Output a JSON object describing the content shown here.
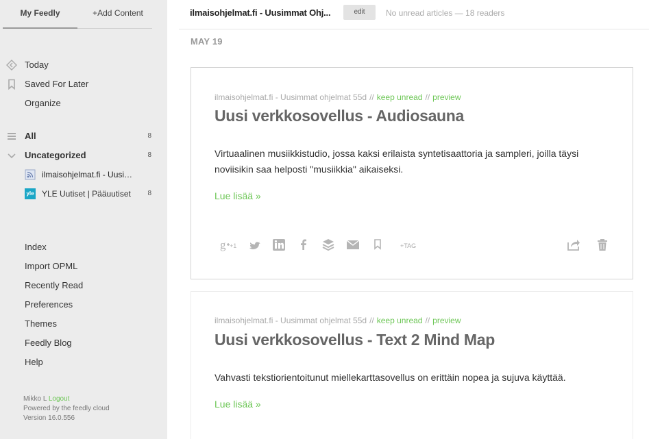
{
  "sidebar": {
    "tabs": {
      "my_feedly": "My Feedly",
      "add_content": "+Add Content"
    },
    "nav": [
      {
        "label": "Today",
        "icon": "today-icon"
      },
      {
        "label": "Saved For Later",
        "icon": "bookmark-icon"
      },
      {
        "label": "Organize"
      }
    ],
    "all": {
      "label": "All",
      "count": "8"
    },
    "category": {
      "label": "Uncategorized",
      "count": "8"
    },
    "feeds": [
      {
        "label": "ilmaisohjelmat.fi - Uusimmat ohjelmat",
        "count": "",
        "icon": "rss-feed-icon"
      },
      {
        "label": "YLE Uutiset | Pääuutiset",
        "count": "8",
        "icon": "yle-logo-icon",
        "icon_text": "yle"
      }
    ],
    "links": [
      "Index",
      "Import OPML",
      "Recently Read",
      "Preferences",
      "Themes",
      "Feedly Blog",
      "Help"
    ],
    "footer": {
      "user": "Mikko L",
      "logout": "Logout",
      "powered": "Powered by the feedly cloud",
      "version": "Version 16.0.556"
    }
  },
  "header": {
    "title": "ilmaisohjelmat.fi - Uusimmat Ohj...",
    "edit_label": "edit",
    "meta": "No unread articles — 18 readers"
  },
  "date_label": "MAY 19",
  "articles": [
    {
      "source": "ilmaisohjelmat.fi - Uusimmat ohjelmat 55d",
      "keep_unread": "keep unread",
      "preview": "preview",
      "title": "Uusi verkkosovellus - Audiosauna",
      "body": "Virtuaalinen musiikkistudio, jossa kaksi erilaista syntetisaattoria ja sampleri, joilla täysi noviisikin saa helposti \"musiikkia\" aikaiseksi.",
      "more": "Lue lisää »",
      "tag_label": "+TAG",
      "gplus_label": "+1"
    },
    {
      "source": "ilmaisohjelmat.fi - Uusimmat ohjelmat 55d",
      "keep_unread": "keep unread",
      "preview": "preview",
      "title": "Uusi verkkosovellus - Text 2 Mind Map",
      "body": "Vahvasti tekstiorientoitunut miellekarttasovellus on erittäin nopea ja sujuva käyttää.",
      "more": "Lue lisää »"
    }
  ],
  "colors": {
    "accent_green": "#6cc655",
    "sidebar_bg": "#ececec",
    "icon_grey": "#b5b5b5"
  }
}
